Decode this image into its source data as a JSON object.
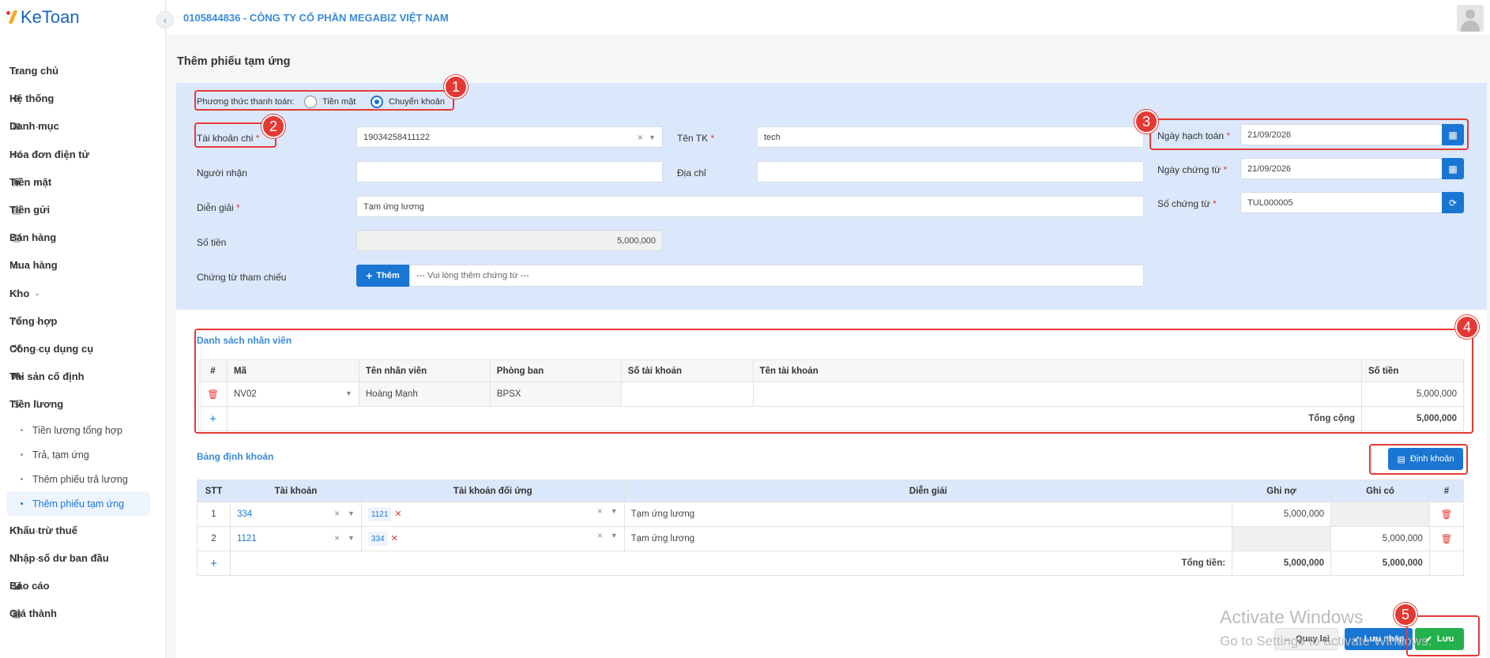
{
  "logo": {
    "name": "KeToan"
  },
  "company": {
    "title": "0105844836 - CÔNG TY CỔ PHẦN MEGABIZ VIỆT NAM"
  },
  "page": {
    "title": "Thêm phiếu tạm ứng"
  },
  "sidebar": {
    "items": [
      {
        "label": "Trang chủ",
        "icon": "home-icon"
      },
      {
        "label": "Hệ thống",
        "icon": "gear-icon"
      },
      {
        "label": "Danh mục",
        "icon": "grid-icon"
      },
      {
        "label": "Hóa đơn điện tử",
        "icon": "invoice-icon"
      },
      {
        "label": "Tiền mặt",
        "icon": "cash-icon"
      },
      {
        "label": "Tiền gửi",
        "icon": "card-icon"
      },
      {
        "label": "Bán hàng",
        "icon": "bag-icon"
      },
      {
        "label": "Mua hàng",
        "icon": "cart-icon"
      },
      {
        "label": "Kho",
        "icon": "warehouse-icon"
      },
      {
        "label": "Tổng hợp",
        "icon": "chart-icon"
      },
      {
        "label": "Công cụ dụng cụ",
        "icon": "tools-icon"
      },
      {
        "label": "Tài sản cố định",
        "icon": "car-icon"
      },
      {
        "label": "Tiền lương",
        "icon": "dollar-icon"
      }
    ],
    "subitems": [
      "Tiền lương tổng hợp",
      "Trả, tạm ứng",
      "Thêm phiếu trả lương",
      "Thêm phiếu tạm ứng"
    ],
    "items_after": [
      {
        "label": "Khấu trừ thuế",
        "icon": "bank-icon"
      },
      {
        "label": "Nhập số dư ban đầu",
        "icon": "import-icon"
      },
      {
        "label": "Báo cáo",
        "icon": "report-icon"
      },
      {
        "label": "Giá thành",
        "icon": "calc-icon"
      }
    ]
  },
  "form": {
    "payment_method_label": "Phương thức thanh toán:",
    "cash_label": "Tiền mặt",
    "transfer_label": "Chuyển khoản",
    "selected_method": "Chuyển khoản",
    "account_label": "Tài khoản chi",
    "account_value": "19034258411122",
    "tentk_label": "Tên TK",
    "tentk_value": "tech",
    "recipient_label": "Người nhận",
    "recipient_value": "",
    "address_label": "Địa chỉ",
    "address_value": "",
    "desc_label": "Diễn giải",
    "desc_value": "Tạm ứng lương",
    "amount_label": "Số tiền",
    "amount_value": "5,000,000",
    "ref_label": "Chứng từ tham chiếu",
    "ref_add_label": "Thêm",
    "ref_placeholder": "--- Vui lòng thêm chứng từ ---",
    "post_date_label": "Ngày hạch toán",
    "post_date_value": "21/09/2026",
    "doc_date_label": "Ngày chứng từ",
    "doc_date_value": "21/09/2026",
    "doc_no_label": "Số chứng từ",
    "doc_no_value": "TUL000005"
  },
  "staff": {
    "title": "Danh sách nhân viên",
    "headers": [
      "#",
      "Mã",
      "Tên nhân viên",
      "Phòng ban",
      "Số tài khoản",
      "Tên tài khoản",
      "Số tiền"
    ],
    "rows": [
      {
        "code": "NV02",
        "name": "Hoàng Mạnh",
        "dept": "BPSX",
        "acc_no": "",
        "acc_name": "",
        "amount": "5,000,000"
      }
    ],
    "total_label": "Tổng cộng",
    "total_value": "5,000,000"
  },
  "ledger": {
    "title": "Bảng định khoản",
    "button_label": "Định khoản",
    "headers": [
      "STT",
      "Tài khoản",
      "Tài khoản đối ứng",
      "Diễn giải",
      "Ghi nợ",
      "Ghi có",
      "#"
    ],
    "rows": [
      {
        "stt": "1",
        "account": "334",
        "contra": "1121",
        "desc": "Tạm ứng lương",
        "debit": "5,000,000",
        "credit": ""
      },
      {
        "stt": "2",
        "account": "1121",
        "contra": "334",
        "desc": "Tạm ứng lương",
        "debit": "",
        "credit": "5,000,000"
      }
    ],
    "total_label": "Tổng tiền:",
    "total_debit": "5,000,000",
    "total_credit": "5,000,000"
  },
  "footer": {
    "back_label": "Quay lại",
    "draft_label": "Lưu nháp",
    "save_label": "Lưu"
  },
  "watermark": {
    "line1": "Activate Windows",
    "line2": "Go to Settings to activate Windows."
  },
  "annotations": [
    "1",
    "2",
    "3",
    "4",
    "5"
  ],
  "colors": {
    "primary": "#1976d2",
    "accent_red": "#e53935",
    "save_green": "#22b14c",
    "panel_bg": "#dbe8fb"
  }
}
